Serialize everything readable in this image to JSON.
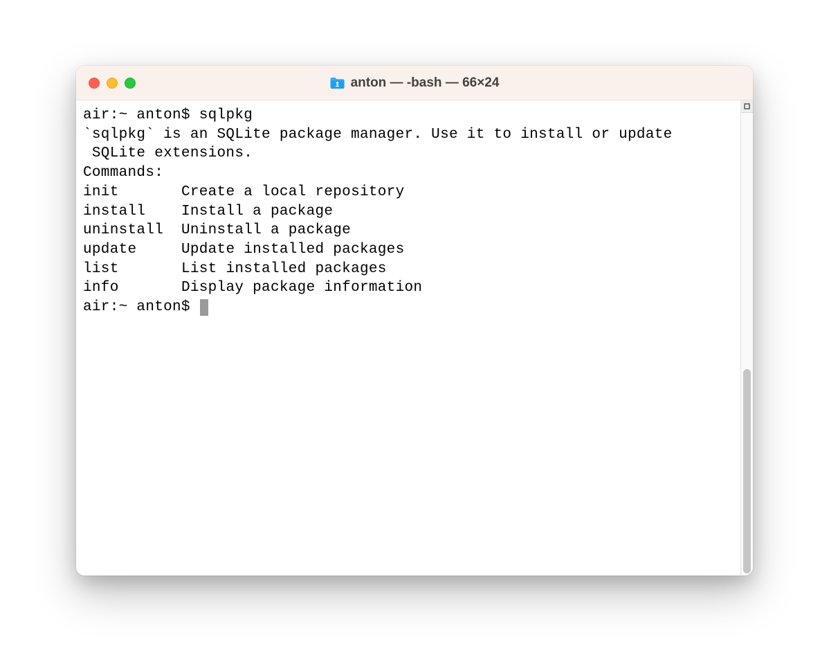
{
  "window": {
    "title": "anton — -bash — 66×24"
  },
  "terminal": {
    "prompt1": "air:~ anton$ ",
    "command": "sqlpkg",
    "description_line1": "`sqlpkg` is an SQLite package manager. Use it to install or update",
    "description_line2": " SQLite extensions.",
    "commands_header": "Commands:",
    "commands": [
      {
        "name": "init",
        "desc": "Create a local repository"
      },
      {
        "name": "install",
        "desc": "Install a package"
      },
      {
        "name": "uninstall",
        "desc": "Uninstall a package"
      },
      {
        "name": "update",
        "desc": "Update installed packages"
      },
      {
        "name": "list",
        "desc": "List installed packages"
      },
      {
        "name": "info",
        "desc": "Display package information"
      }
    ],
    "prompt2": "air:~ anton$ "
  }
}
